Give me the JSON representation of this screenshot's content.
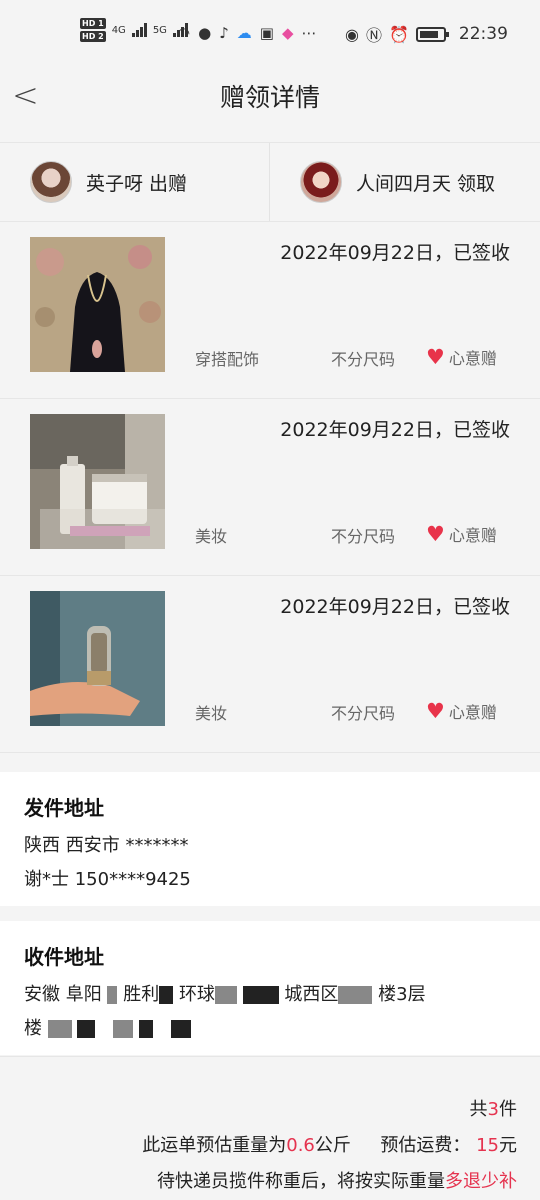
{
  "status_bar": {
    "hd1": "HD 1",
    "hd2": "HD 2",
    "net1": "4G",
    "net2": "5G",
    "time": "22:39"
  },
  "header": {
    "title": "赠领详情"
  },
  "parties": {
    "giver": "英子呀 出赠",
    "receiver": "人间四月天 领取"
  },
  "items": [
    {
      "date": "2022年09月22日，已签收",
      "category": "穿搭配饰",
      "size": "不分尺码",
      "tag": "心意赠"
    },
    {
      "date": "2022年09月22日，已签收",
      "category": "美妆",
      "size": "不分尺码",
      "tag": "心意赠"
    },
    {
      "date": "2022年09月22日，已签收",
      "category": "美妆",
      "size": "不分尺码",
      "tag": "心意赠"
    }
  ],
  "sender_address": {
    "title": "发件地址",
    "region": "陕西 西安市 *******",
    "contact": "谢*士 150****9425"
  },
  "receiver_address": {
    "title": "收件地址",
    "line1_a": "安徽 阜阳",
    "line1_b": "胜利",
    "line1_c": "环球",
    "line1_d": "城西区",
    "line1_e": "楼3层",
    "line2_a": "楼"
  },
  "summary": {
    "count_prefix": "共",
    "count": "3",
    "count_suffix": "件",
    "weight_prefix": "此运单预估重量为",
    "weight_value": "0.6",
    "weight_unit": "公斤",
    "fee_label": "预估运费：",
    "fee_value": "15",
    "fee_unit": "元",
    "note_prefix": "待快递员揽件称重后，将按实际重量",
    "note_highlight": "多退少补"
  },
  "colors": {
    "accent_red": "#e5334f",
    "heart": "#e8334a"
  }
}
